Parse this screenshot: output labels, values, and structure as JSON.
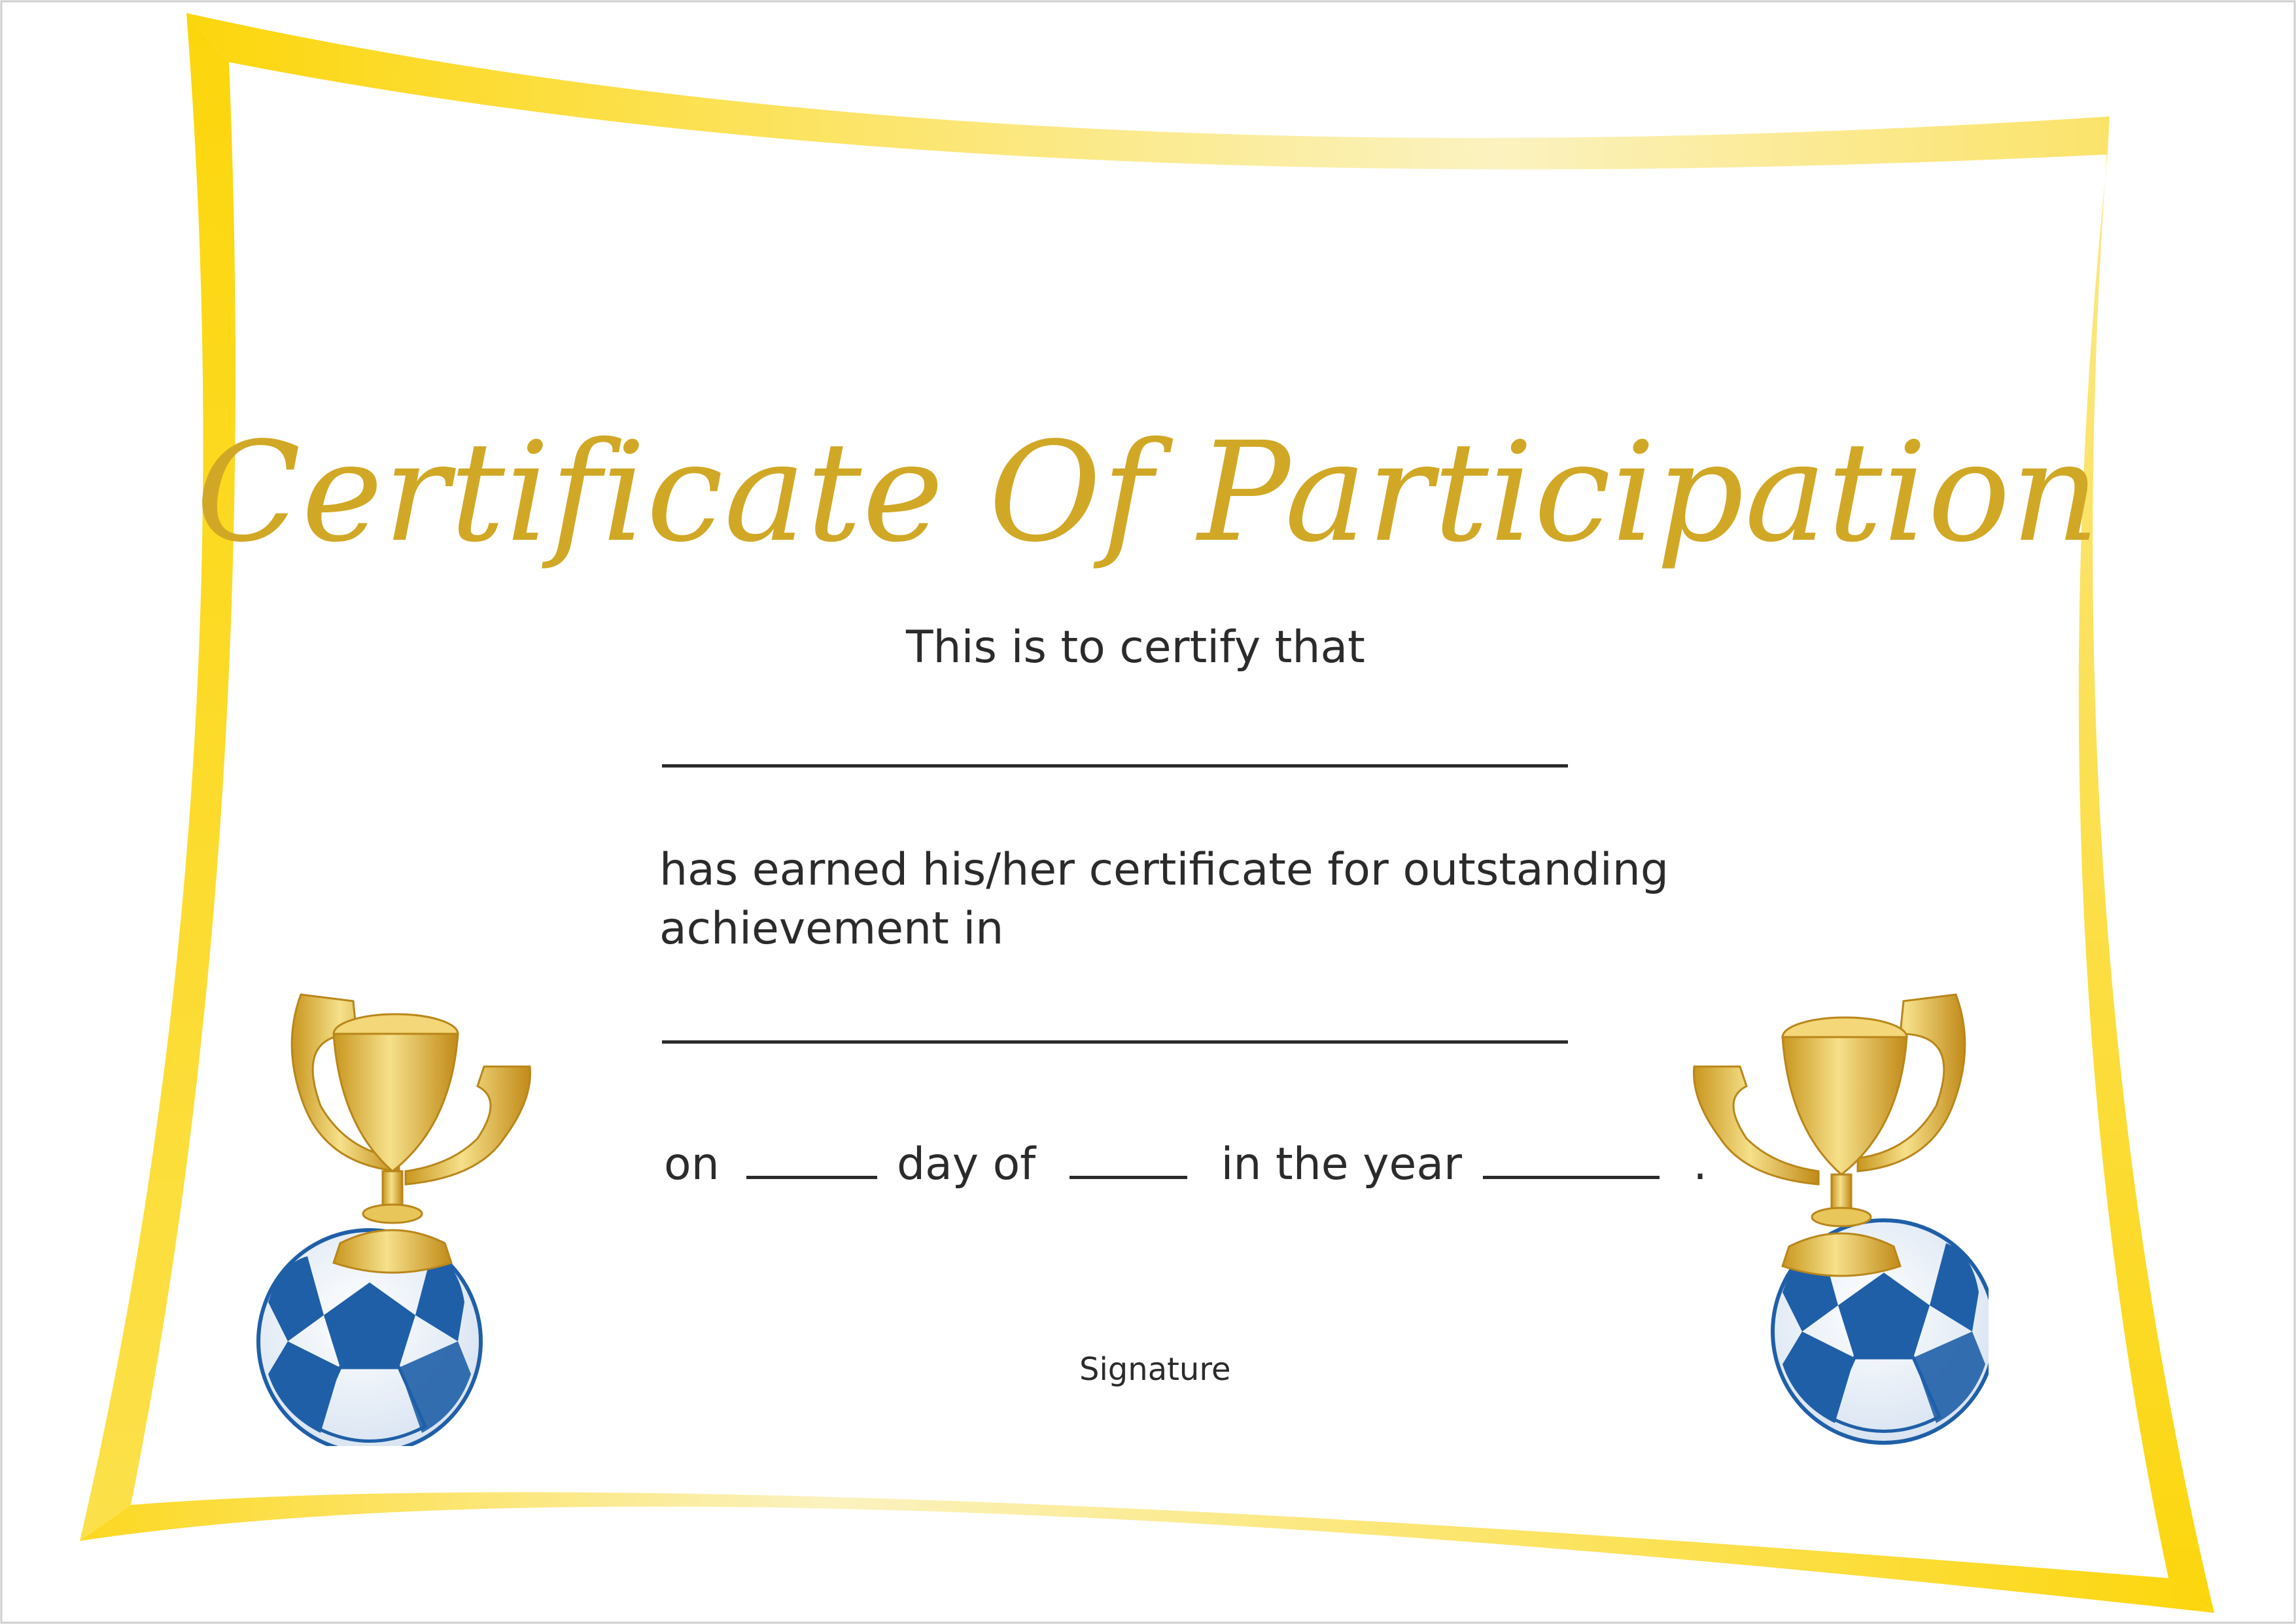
{
  "certificate": {
    "title": "Certificate Of Participation",
    "intro": "This is to certify that",
    "body_line_1": "has earned his/her certificate for outstanding",
    "body_line_2": "achievement in",
    "date_on": "on",
    "date_day_of": "day of",
    "date_in_the_year": "in the year",
    "date_end": ".",
    "signature_label": "Signature"
  },
  "colors": {
    "frame_gold": "#f7d21e",
    "frame_light": "#fbf0b4",
    "title_gold": "#d1a826",
    "ball_blue": "#1f5fa8",
    "text": "#2b2b2b"
  },
  "icons": {
    "left_decoration": "trophy-on-soccer-ball-icon",
    "right_decoration": "trophy-on-soccer-ball-icon"
  }
}
